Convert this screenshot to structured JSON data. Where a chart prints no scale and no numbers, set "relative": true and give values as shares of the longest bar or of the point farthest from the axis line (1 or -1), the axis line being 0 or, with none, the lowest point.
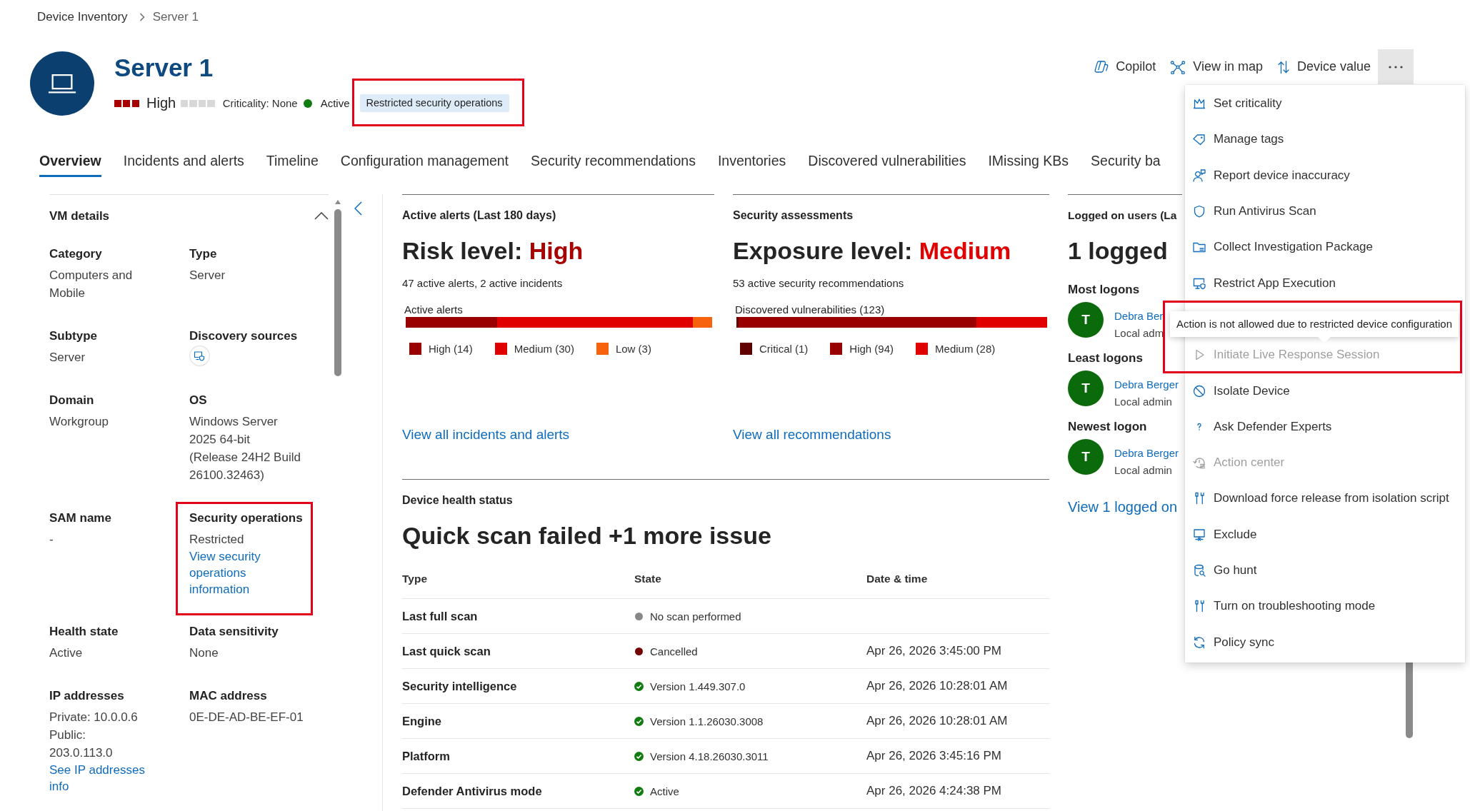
{
  "breadcrumb": [
    {
      "label": "Device Inventory",
      "current": false
    },
    {
      "label": "Server 1",
      "current": true
    }
  ],
  "device": {
    "name": "Server 1",
    "risk": {
      "label": "High",
      "level": 1
    },
    "criticality": {
      "label": "Criticality: None",
      "level": 0
    },
    "status": {
      "label": "Active",
      "kind": "active"
    },
    "badge": {
      "label": "Restricted security operations",
      "highlighted": true
    }
  },
  "actions": [
    {
      "label": "Copilot"
    },
    {
      "label": "View in map"
    },
    {
      "label": "Device value"
    }
  ],
  "more_button": {
    "expanded": true
  },
  "tabs": [
    {
      "label": "Overview",
      "selected": true
    },
    {
      "label": "Incidents and alerts",
      "selected": false
    },
    {
      "label": "Timeline",
      "selected": false
    },
    {
      "label": "Configuration management",
      "selected": false
    },
    {
      "label": "Security recommendations",
      "selected": false
    },
    {
      "label": "Inventories",
      "selected": false
    },
    {
      "label": "Discovered vulnerabilities",
      "selected": false
    },
    {
      "label": "IMissing KBs",
      "selected": false
    },
    {
      "label": "Security ba",
      "selected": false
    }
  ],
  "vm_details": {
    "title": "VM details",
    "expanded": true,
    "fields": [
      {
        "kind": "text",
        "label": "Category",
        "lines": [
          "Computers and Mobile"
        ],
        "highlighted": false
      },
      {
        "kind": "text",
        "label": "Type",
        "lines": [
          "Server"
        ],
        "highlighted": false
      },
      {
        "kind": "text",
        "label": "Subtype",
        "lines": [
          "Server"
        ],
        "highlighted": false
      },
      {
        "kind": "icon",
        "label": "Discovery sources",
        "highlighted": false
      },
      {
        "kind": "text",
        "label": "Domain",
        "lines": [
          "Workgroup"
        ],
        "highlighted": false
      },
      {
        "kind": "text",
        "label": "OS",
        "lines": [
          "Windows Server 2025 64-bit (Release 24H2 Build 26100.32463)"
        ],
        "highlighted": false
      },
      {
        "kind": "text",
        "label": "SAM name",
        "lines": [
          "-"
        ],
        "highlighted": false
      },
      {
        "kind": "text",
        "label": "Security operations",
        "lines": [
          "Restricted"
        ],
        "link": "View security operations information",
        "highlighted": true
      },
      {
        "kind": "text",
        "label": "Health state",
        "lines": [
          "Active"
        ],
        "highlighted": false
      },
      {
        "kind": "text",
        "label": "Data sensitivity",
        "lines": [
          "None"
        ],
        "highlighted": false
      },
      {
        "kind": "text",
        "label": "IP addresses",
        "lines": [
          "Private: 10.0.0.6",
          "Public: 203.0.113.0"
        ],
        "link": "See IP addresses info",
        "highlighted": false
      },
      {
        "kind": "text",
        "label": "MAC address",
        "lines": [
          "0E-DE-AD-BE-EF-01"
        ],
        "highlighted": false
      }
    ]
  },
  "summary_cards": [
    {
      "heading": "Active alerts (Last 180 days)",
      "headline": "Risk level:",
      "rating": "High",
      "color": "#a80000",
      "summary": "47 active alerts, 2 active incidents",
      "chart_data": {
        "type": "bar",
        "title": "Active alerts",
        "orientation": "horizontal",
        "stacked": true,
        "relative": true,
        "legend": "bottom",
        "categories": [
          null
        ],
        "series": [
          {
            "name": "High (14)",
            "color": "#990000",
            "values": [
              0.298
            ]
          },
          {
            "name": "Medium (30)",
            "color": "#e00000",
            "values": [
              0.638
            ]
          },
          {
            "name": "Low (3)",
            "color": "#f7630c",
            "values": [
              0.064
            ]
          }
        ]
      },
      "link": "View all incidents and alerts"
    },
    {
      "heading": "Security assessments",
      "headline": "Exposure level:",
      "rating": "Medium",
      "color": "#e00000",
      "summary": "53 active security recommendations",
      "chart_data": {
        "type": "bar",
        "title": "Discovered vulnerabilities (123)",
        "orientation": "horizontal",
        "stacked": true,
        "relative": true,
        "legend": "bottom",
        "categories": [
          null
        ],
        "series": [
          {
            "name": "Critical (1)",
            "color": "#600000",
            "values": [
              0.008
            ]
          },
          {
            "name": "High (94)",
            "color": "#990000",
            "values": [
              0.764
            ]
          },
          {
            "name": "Medium (28)",
            "color": "#e00000",
            "values": [
              0.228
            ]
          }
        ]
      },
      "link": "View all recommendations"
    }
  ],
  "health": {
    "heading": "Device health status",
    "headline": "Quick scan failed +1 more issue",
    "columns": [
      "Type",
      "State",
      "Date & time"
    ],
    "rows": [
      {
        "type": "Last full scan",
        "state": {
          "kind": "dot",
          "color": "#8a8886",
          "text": "No scan performed"
        }
      },
      {
        "type": "Last quick scan",
        "state": {
          "kind": "dot",
          "color": "#750000",
          "text": "Cancelled"
        },
        "date": "Apr 26, 2026 3:45:00 PM"
      },
      {
        "type": "Security intelligence",
        "state": {
          "kind": "check",
          "color": "#107c10",
          "text": "Version 1.449.307.0"
        },
        "date": "Apr 26, 2026 10:28:01 AM"
      },
      {
        "type": "Engine",
        "state": {
          "kind": "check",
          "color": "#107c10",
          "text": "Version 1.1.26030.3008"
        },
        "date": "Apr 26, 2026 10:28:01 AM"
      },
      {
        "type": "Platform",
        "state": {
          "kind": "check",
          "color": "#107c10",
          "text": "Version 4.18.26030.3011"
        },
        "date": "Apr 26, 2026 3:45:16 PM"
      },
      {
        "type": "Defender Antivirus mode",
        "state": {
          "kind": "check",
          "color": "#107c10",
          "text": "Active"
        },
        "date": "Apr 26, 2026 4:24:38 PM"
      }
    ]
  },
  "logged_on_users": {
    "heading": "Logged on users (La",
    "headline": "1 logged",
    "groups": [
      {
        "title": "Most logons",
        "initial": "T",
        "name": "Debra Ber",
        "role": "Local adm"
      },
      {
        "title": "Least logons",
        "initial": "T",
        "name": "Debra Berger",
        "role": "Local admin"
      },
      {
        "title": "Newest logon",
        "initial": "T",
        "name": "Debra Berger",
        "role": "Local admin"
      }
    ],
    "link": "View 1 logged on"
  },
  "menu": {
    "items": [
      {
        "label": "Set criticality",
        "disabled": false,
        "highlighted": false
      },
      {
        "label": "Manage tags",
        "disabled": false,
        "highlighted": false
      },
      {
        "label": "Report device inaccuracy",
        "disabled": false,
        "highlighted": false
      },
      {
        "label": "Run Antivirus Scan",
        "disabled": false,
        "highlighted": false
      },
      {
        "label": "Collect Investigation Package",
        "disabled": false,
        "highlighted": false
      },
      {
        "label": "Restrict App Execution",
        "disabled": false,
        "highlighted": false
      },
      {
        "label": "Initiate Live Response Session",
        "disabled": true,
        "highlighted": true,
        "tooltip": "Action is not allowed due to restricted device configuration"
      },
      {
        "label": "Isolate Device",
        "disabled": false,
        "highlighted": false
      },
      {
        "label": "Ask Defender Experts",
        "disabled": false,
        "highlighted": false
      },
      {
        "label": "Action center",
        "disabled": true,
        "highlighted": false
      },
      {
        "label": "Download force release from isolation script",
        "disabled": false,
        "highlighted": false
      },
      {
        "label": "Exclude",
        "disabled": false,
        "highlighted": false
      },
      {
        "label": "Go hunt",
        "disabled": false,
        "highlighted": false
      },
      {
        "label": "Turn on troubleshooting mode",
        "disabled": false,
        "highlighted": false
      },
      {
        "label": "Policy sync",
        "disabled": false,
        "highlighted": false
      }
    ]
  }
}
